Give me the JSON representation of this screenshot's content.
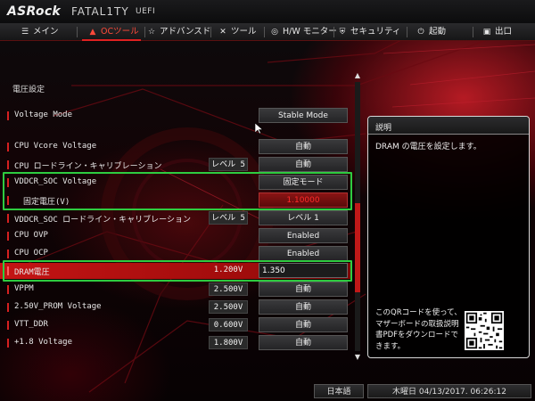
{
  "app": {
    "brand": "ASRock",
    "product": "FATAL1TY",
    "suffix": "UEFI"
  },
  "nav": {
    "items": [
      {
        "label": "メイン",
        "icon": "list-icon",
        "active": false
      },
      {
        "label": "OCツール",
        "icon": "flame-icon",
        "active": true
      },
      {
        "label": "アドバンスド",
        "icon": "star-icon",
        "active": false
      },
      {
        "label": "ツール",
        "icon": "wrench-icon",
        "active": false
      },
      {
        "label": "H/W モニター",
        "icon": "hw-monitor-icon",
        "active": false
      },
      {
        "label": "セキュリティ",
        "icon": "shield-icon",
        "active": false
      },
      {
        "label": "起動",
        "icon": "power-icon",
        "active": false
      },
      {
        "label": "出口",
        "icon": "exit-icon",
        "active": false
      }
    ]
  },
  "section": {
    "title": "電圧設定"
  },
  "rows": [
    {
      "label": "Voltage Mode",
      "current": "",
      "value": "Stable Mode"
    },
    {
      "label": "CPU Vcore Voltage",
      "current": "",
      "value": "自動"
    },
    {
      "label": "CPU ロードライン・キャリブレーション",
      "current": "レベル 5",
      "value": "自動"
    },
    {
      "label": "VDDCR_SOC Voltage",
      "current": "",
      "value": "固定モード"
    },
    {
      "label": "固定電圧(V)",
      "current": "",
      "value": "1.10000"
    },
    {
      "label": "VDDCR_SOC ロードライン・キャリブレーション",
      "current": "レベル 5",
      "value": "レベル 1"
    },
    {
      "label": "CPU OVP",
      "current": "",
      "value": "Enabled"
    },
    {
      "label": "CPU OCP",
      "current": "",
      "value": "Enabled"
    },
    {
      "label": "DRAM電圧",
      "current": "1.200V",
      "value": "1.350"
    },
    {
      "label": "VPPM",
      "current": "2.500V",
      "value": "自動"
    },
    {
      "label": "2.50V_PROM Voltage",
      "current": "2.500V",
      "value": "自動"
    },
    {
      "label": "VTT_DDR",
      "current": "0.600V",
      "value": "自動"
    },
    {
      "label": "+1.8 Voltage",
      "current": "1.800V",
      "value": "自動"
    }
  ],
  "description": {
    "title": "説明",
    "text": "DRAM の電圧を設定します。",
    "qr_text": "このQRコードを使って、マザーボードの取扱説明書PDFをダウンロードできます。"
  },
  "footer": {
    "language": "日本語",
    "datetime": "木曜日 04/13/2017. 06:26:12"
  },
  "colors": {
    "accent": "#d52020",
    "highlight": "#2ecc40",
    "selected_row": "#c41414"
  }
}
